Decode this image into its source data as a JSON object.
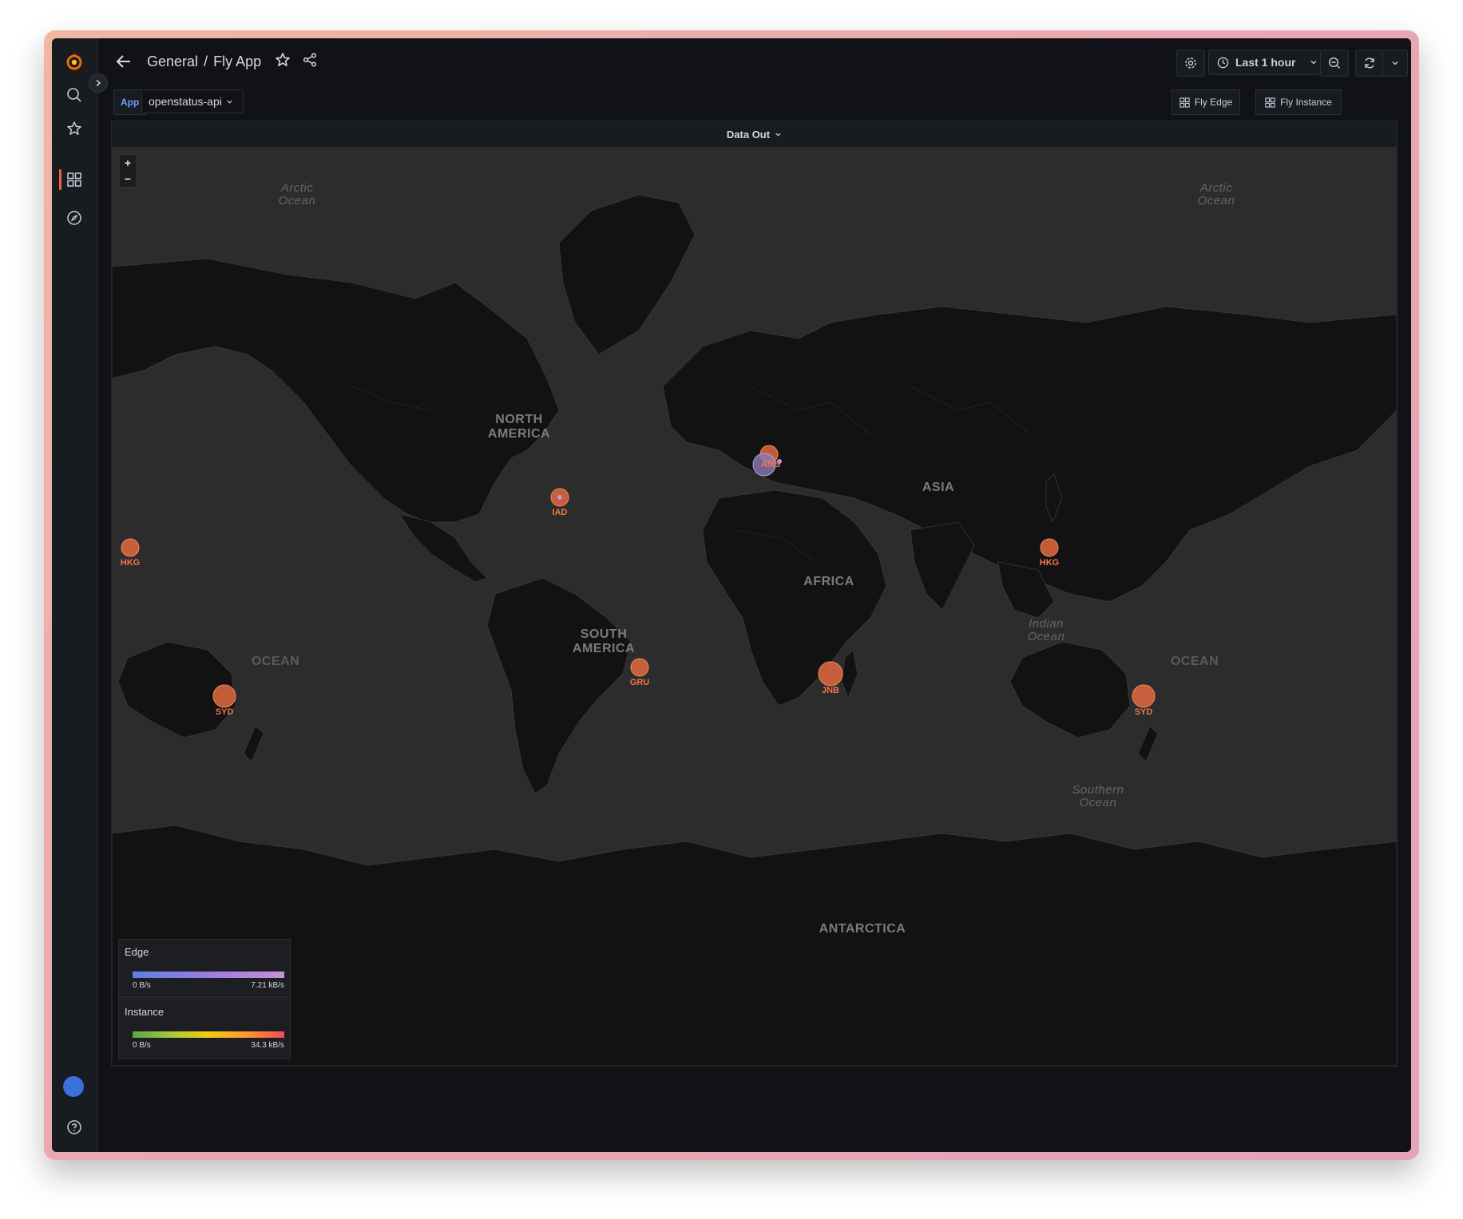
{
  "breadcrumb": {
    "folder": "General",
    "separator": "/",
    "dashboard": "Fly App"
  },
  "toolbar": {
    "time_range": "Last 1 hour"
  },
  "variables": {
    "app_label": "App",
    "app_value": "openstatus-api"
  },
  "links": {
    "fly_edge": "Fly Edge",
    "fly_instance": "Fly Instance"
  },
  "panel": {
    "title": "Data Out"
  },
  "zoom": {
    "in": "+",
    "out": "−"
  },
  "map_labels": {
    "arctic_ocean": "Arctic\nOcean",
    "north_america": "NORTH\nAMERICA",
    "south_america": "SOUTH\nAMERICA",
    "africa": "AFRICA",
    "asia": "ASIA",
    "indian_ocean": "Indian\nOcean",
    "southern_ocean": "Southern\nOcean",
    "ocean": "OCEAN",
    "antarctica": "ANTARCTICA"
  },
  "markers": [
    {
      "code": "HKG"
    },
    {
      "code": "IAD"
    },
    {
      "code": "AMS"
    },
    {
      "code": "HKG"
    },
    {
      "code": "GRU"
    },
    {
      "code": "JNB"
    },
    {
      "code": "SYD"
    },
    {
      "code": "SYD"
    }
  ],
  "legend": {
    "edge": {
      "title": "Edge",
      "min": "0 B/s",
      "max": "7.21 kB/s"
    },
    "instance": {
      "title": "Instance",
      "min": "0 B/s",
      "max": "34.3 kB/s"
    }
  },
  "colors": {
    "brand": "#f55f3e",
    "marker": "#e4683f",
    "edge_marker": "#8c7ab8",
    "background": "#111217"
  }
}
